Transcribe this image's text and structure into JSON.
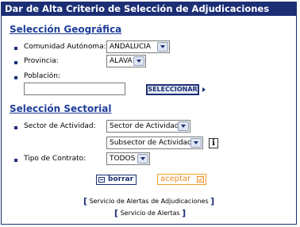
{
  "title": "Dar de Alta Criterio de Selección de Adjudicaciones",
  "geo": {
    "heading": "Selección Geográfica",
    "comunidad_label": "Comunidad Autónoma:",
    "comunidad_value": "ANDALUCIA",
    "provincia_label": "Provincia:",
    "provincia_value": "ALAVA",
    "poblacion_label": "Población:",
    "poblacion_value": "",
    "seleccionar_label": "SELECCIONAR"
  },
  "sector": {
    "heading": "Selección Sectorial",
    "sector_label": "Sector de Actividad:",
    "sector_value": "Sector de Actividad",
    "subsector_value": "Subsector de Actividad",
    "info_glyph": "i",
    "tipo_label": "Tipo de Contrato:",
    "tipo_value": "TODOS"
  },
  "actions": {
    "borrar_label": "borrar",
    "aceptar_label": "aceptar"
  },
  "links": {
    "alertas_adjudicaciones": "Servicio de Alertas de Adjudicaciones",
    "alertas": "Servicio de Alertas"
  },
  "colors": {
    "brand": "#1c2f75",
    "section": "#1f3d99",
    "accent": "#f08a1c"
  },
  "icons": [
    "info-icon",
    "minus-icon",
    "check-icon",
    "chevron-down-icon",
    "arrow-right-icon"
  ]
}
